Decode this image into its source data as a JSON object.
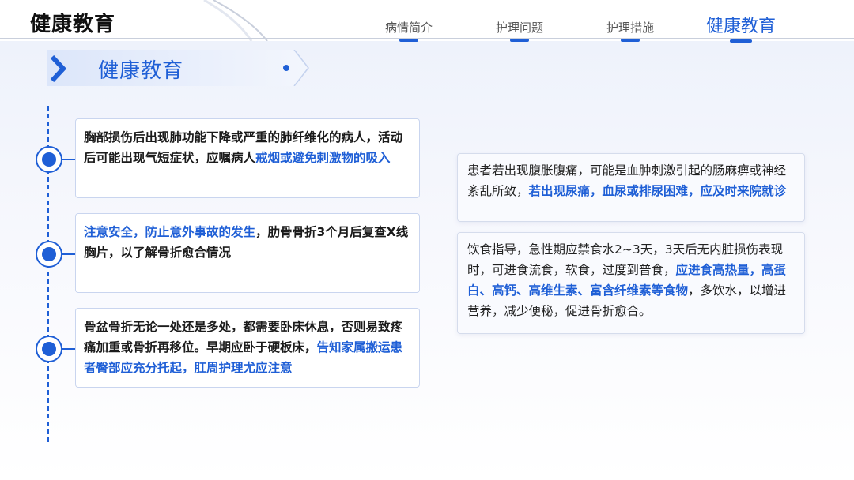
{
  "header": {
    "title": "健康教育",
    "nav": [
      {
        "label": "病情简介"
      },
      {
        "label": "护理问题"
      },
      {
        "label": "护理措施"
      },
      {
        "label": "健康教育"
      }
    ]
  },
  "section": {
    "title": "健康教育"
  },
  "left_cards": [
    {
      "text": "胸部损伤后出现肺功能下降或严重的肺纤维化的病人，活动后可能出现气短症状，应嘱病人",
      "highlight": "戒烟或避免刺激物的吸入",
      "tail": ""
    },
    {
      "text": "",
      "highlight": "注意安全，防止意外事故的发生",
      "tail": "，肋骨骨折3个月后复查X线胸片，以了解骨折愈合情况"
    },
    {
      "text": "骨盆骨折无论一处还是多处，都需要卧床休息，否则易致疼痛加重或骨折再移位。早期应卧于硬板床，",
      "highlight": "告知家属搬运患者臀部应充分托起，肛周护理尤应注意",
      "tail": ""
    }
  ],
  "right_cards": [
    {
      "text": "患者若出现腹胀腹痛，可能是血肿刺激引起的肠麻痹或神经紊乱所致，",
      "highlight": "若出现尿痛，血尿或排尿困难，应及时来院就诊",
      "tail": ""
    },
    {
      "text": "饮食指导，急性期应禁食水2~3天，3天后无内脏损伤表现时，可进食流食，软食，过度到普食，",
      "highlight": "应进食高热量，高蛋白、高钙、高维生素、富含纤维素等食物",
      "tail": "，多饮水，以增进营养，减少便秘，促进骨折愈合。"
    }
  ],
  "colors": {
    "accent": "#1f5fd6",
    "text": "#1b1b1b"
  }
}
